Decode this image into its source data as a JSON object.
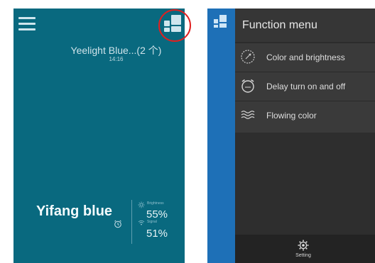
{
  "left": {
    "device_title": "Yeelight Blue...(2 个)",
    "time": "14:16",
    "device_name": "Yifang blue",
    "brightness": {
      "label": "Brightness",
      "value": "55%"
    },
    "signal": {
      "label": "Signal",
      "value": "51%"
    },
    "colors": {
      "background": "#09697f",
      "highlight": "#e02020"
    }
  },
  "right": {
    "menu_title": "Function menu",
    "items": [
      {
        "label": "Color and brightness",
        "icon": "color-wheel-icon"
      },
      {
        "label": "Delay turn on and off",
        "icon": "alarm-clock-icon"
      },
      {
        "label": "Flowing color",
        "icon": "waves-icon"
      }
    ],
    "setting_label": "Setting",
    "colors": {
      "strip": "#1e70b7",
      "panel": "#2d2d2d"
    }
  }
}
